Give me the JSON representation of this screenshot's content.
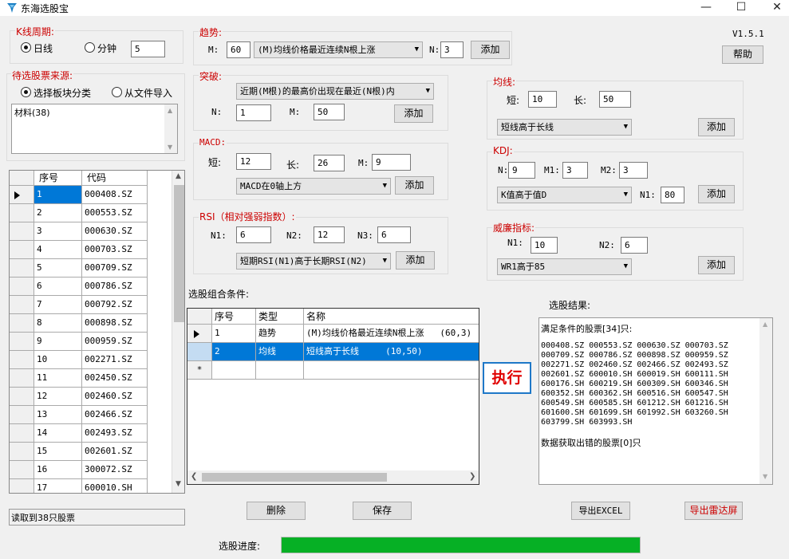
{
  "app": {
    "title": "东海选股宝",
    "version": "V1.5.1",
    "help_label": "帮助"
  },
  "kline": {
    "label": "K线周期:",
    "daily": "日线",
    "minute": "分钟",
    "minute_value": "5",
    "selected": "daily"
  },
  "source": {
    "label": "待选股票来源:",
    "sector": "选择板块分类",
    "file": "从文件导入",
    "selected": "sector",
    "list_item": "材料(38)"
  },
  "stock_table": {
    "headers": [
      "序号",
      "代码"
    ],
    "rows": [
      [
        "1",
        "000408.SZ"
      ],
      [
        "2",
        "000553.SZ"
      ],
      [
        "3",
        "000630.SZ"
      ],
      [
        "4",
        "000703.SZ"
      ],
      [
        "5",
        "000709.SZ"
      ],
      [
        "6",
        "000786.SZ"
      ],
      [
        "7",
        "000792.SZ"
      ],
      [
        "8",
        "000898.SZ"
      ],
      [
        "9",
        "000959.SZ"
      ],
      [
        "10",
        "002271.SZ"
      ],
      [
        "11",
        "002450.SZ"
      ],
      [
        "12",
        "002460.SZ"
      ],
      [
        "13",
        "002466.SZ"
      ],
      [
        "14",
        "002493.SZ"
      ],
      [
        "15",
        "002601.SZ"
      ],
      [
        "16",
        "300072.SZ"
      ],
      [
        "17",
        "600010.SH"
      ]
    ]
  },
  "status_text": "读取到38只股票",
  "trend": {
    "label": "趋势:",
    "m_label": "M:",
    "m_value": "60",
    "select": "(M)均线价格最近连续N根上涨",
    "n_label": "N:",
    "n_value": "3",
    "add": "添加"
  },
  "breakout": {
    "label": "突破:",
    "select": "近期(M根)的最高价出现在最近(N根)内",
    "n_label": "N:",
    "n_value": "1",
    "m_label": "M:",
    "m_value": "50",
    "add": "添加"
  },
  "macd": {
    "label": "MACD:",
    "short_label": "短:",
    "short_value": "12",
    "long_label": "长:",
    "long_value": "26",
    "m_label": "M:",
    "m_value": "9",
    "select": "MACD在0轴上方",
    "add": "添加"
  },
  "rsi": {
    "label": "RSI（相对强弱指数）:",
    "n1_label": "N1:",
    "n1_value": "6",
    "n2_label": "N2:",
    "n2_value": "12",
    "n3_label": "N3:",
    "n3_value": "6",
    "select": "短期RSI(N1)高于长期RSI(N2)",
    "add": "添加"
  },
  "ma": {
    "label": "均线:",
    "short_label": "短:",
    "short_value": "10",
    "long_label": "长:",
    "long_value": "50",
    "select": "短线高于长线",
    "add": "添加"
  },
  "kdj": {
    "label": "KDJ:",
    "n_label": "N:",
    "n_value": "9",
    "m1_label": "M1:",
    "m1_value": "3",
    "m2_label": "M2:",
    "m2_value": "3",
    "select": "K值高于值D",
    "n1_label": "N1:",
    "n1_value": "80",
    "add": "添加"
  },
  "wr": {
    "label": "威廉指标:",
    "n1_label": "N1:",
    "n1_value": "10",
    "n2_label": "N2:",
    "n2_value": "6",
    "select": "WR1高于85",
    "add": "添加"
  },
  "conditions": {
    "label": "选股组合条件:",
    "headers": [
      "序号",
      "类型",
      "名称"
    ],
    "rows": [
      {
        "no": "1",
        "type": "趋势",
        "name": "(M)均线价格最近连续N根上涨",
        "params": "(60,3)"
      },
      {
        "no": "2",
        "type": "均线",
        "name": "短线高于长线",
        "params": "(10,50)"
      }
    ],
    "new_row_marker": "*"
  },
  "execute_label": "执行",
  "result": {
    "label": "选股结果:",
    "line1": "满足条件的股票[34]只:",
    "codes": [
      "000408.SZ 000553.SZ 000630.SZ 000703.SZ",
      "000709.SZ 000786.SZ 000898.SZ 000959.SZ",
      "002271.SZ 002460.SZ 002466.SZ 002493.SZ",
      "002601.SZ 600010.SH 600019.SH 600111.SH",
      "600176.SH 600219.SH 600309.SH 600346.SH",
      "600352.SH 600362.SH 600516.SH 600547.SH",
      "600549.SH 600585.SH 601212.SH 601216.SH",
      "601600.SH 601699.SH 601992.SH 603260.SH",
      "603799.SH 603993.SH"
    ],
    "error_line": "数据获取出错的股票[0]只"
  },
  "actions": {
    "delete": "删除",
    "save": "保存",
    "export_excel": "导出EXCEL",
    "export_radar": "导出雷达屏"
  },
  "progress": {
    "label": "选股进度:",
    "fraction": 1.0,
    "color": "#06b025"
  },
  "colors": {
    "accent_red": "#cc0000",
    "selection_blue": "#0078d7",
    "execute_blue": "#1e78c8"
  }
}
